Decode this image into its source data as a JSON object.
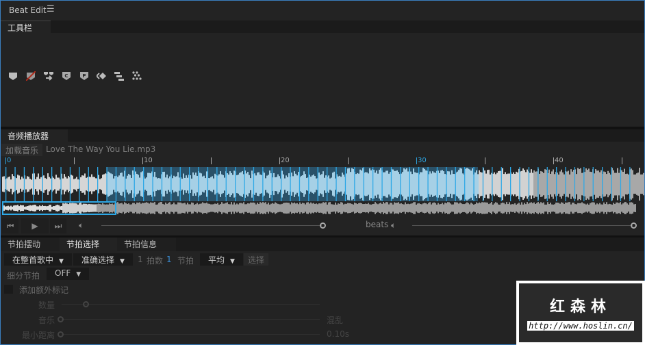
{
  "window": {
    "title": "Beat Edit",
    "menu_icon": "hamburger-icon"
  },
  "toolbar": {
    "tab": "工具栏",
    "icons": [
      "marker-icon",
      "remove-marker-icon",
      "merge-markers-icon",
      "marker-c-icon",
      "marker-p-icon",
      "navigate-markers-icon",
      "align-markers-icon",
      "scatter-markers-icon"
    ]
  },
  "player": {
    "tab": "音频播放器",
    "load_button": "加载音乐",
    "file_name": "Love The Way You Lie.mp3",
    "ruler_labels": [
      "0",
      "10",
      "20",
      "30",
      "40"
    ],
    "beats_label": "beats",
    "accent": "#2ea8e6"
  },
  "beat_panel": {
    "tabs": [
      "节拍摆动",
      "节拍选择",
      "节拍信息"
    ],
    "active_tab": 1,
    "scope_select": "在整首歌中",
    "mode_select": "准确选择",
    "count_a": "1",
    "beats_label": "拍数",
    "count_b": "1",
    "beat_label": "节拍",
    "distribution_select": "平均",
    "select_button": "选择",
    "subdivide_label": "细分节拍",
    "subdivide_value": "OFF",
    "extra_markers_label": "添加额外标记",
    "quantity_label": "数量",
    "music_label": "音乐",
    "chaos_label": "混乱",
    "min_distance_label": "最小距离",
    "min_distance_value": "0.10s"
  },
  "watermark": {
    "title": "红森林",
    "url": "http://www.hoslin.cn/"
  }
}
